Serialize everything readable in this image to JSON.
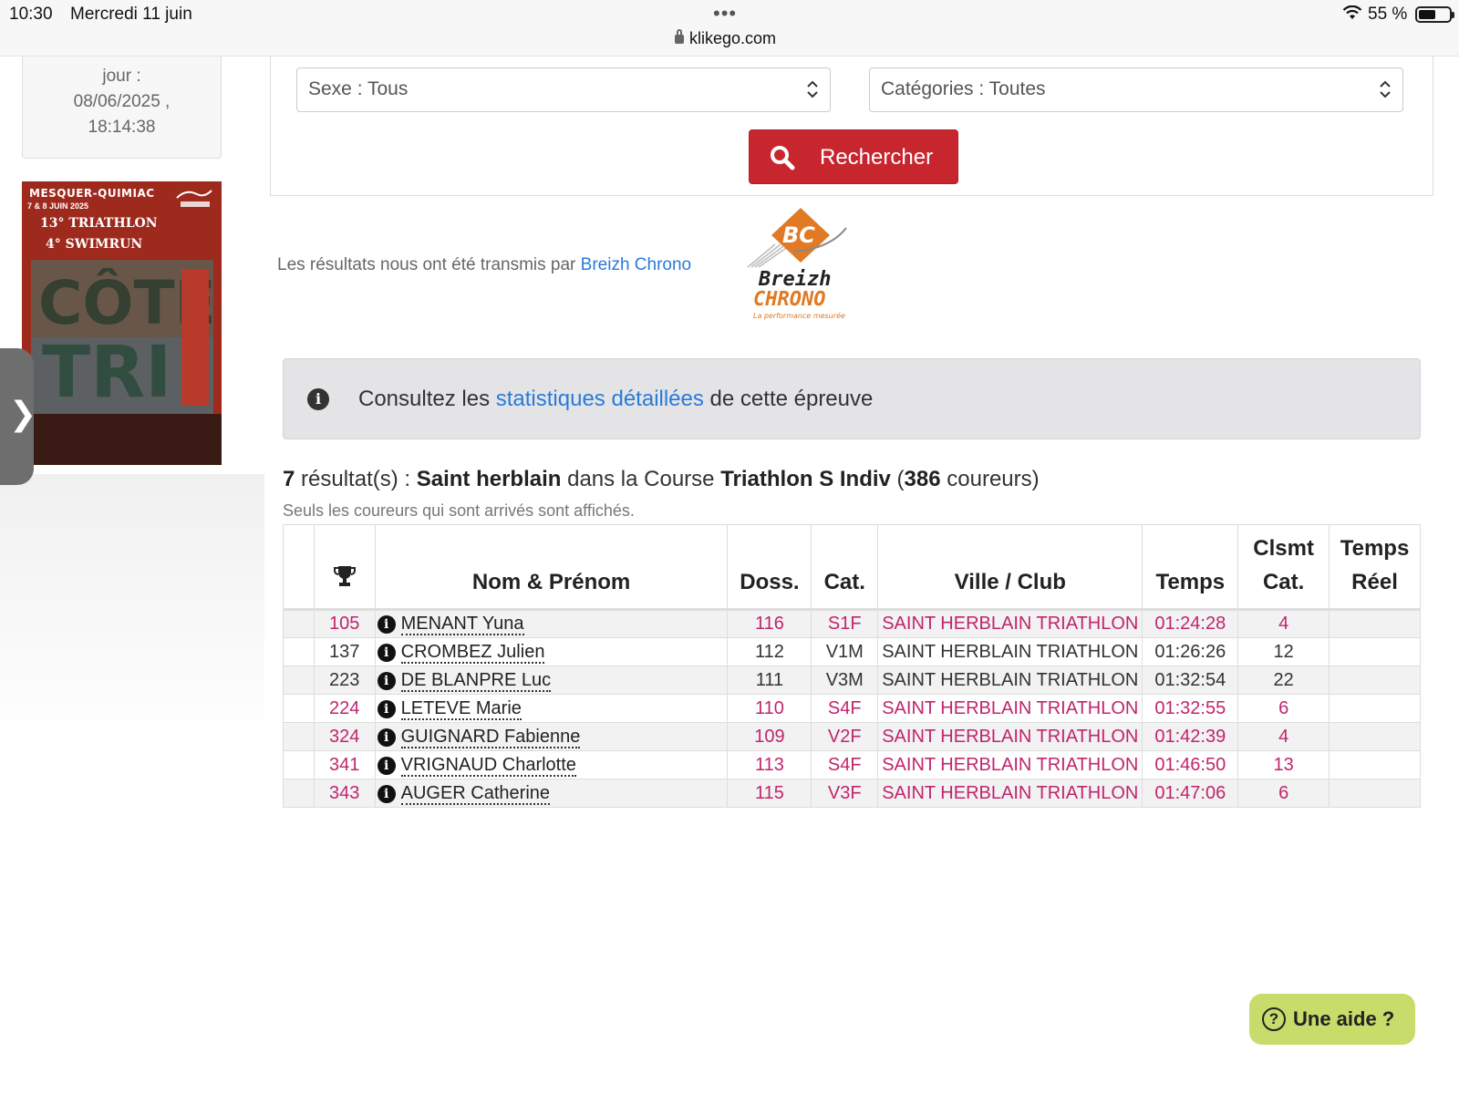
{
  "status_bar": {
    "time": "10:30",
    "date": "Mercredi 11 juin",
    "dots": "•••",
    "url": "klikego.com",
    "battery": "55 %"
  },
  "sidebar": {
    "update_lines": [
      "jour :",
      "08/06/2025 ,",
      "18:14:38"
    ],
    "poster": {
      "title": "MESQUER-QUIMIAC",
      "dates": "7 & 8 JUIN 2025",
      "line1": "13° TRIATHLON",
      "line2": "4° SWIMRUN"
    },
    "toggle": "❯"
  },
  "filters": {
    "sexe": "Sexe : Tous",
    "categories": "Catégories : Toutes",
    "search_label": "Rechercher"
  },
  "provider": {
    "text": "Les résultats nous ont été transmis par ",
    "link": "Breizh Chrono",
    "logo_text1": "Breizh",
    "logo_text2": "CHRONO",
    "logo_text3": "La performance mesurée"
  },
  "info": {
    "before": "Consultez les ",
    "link": "statistiques détaillées",
    "after": " de cette épreuve"
  },
  "result": {
    "count": "7",
    "label": " résultat(s) : ",
    "club": "Saint herblain",
    "middle": " dans la Course ",
    "course": "Triathlon S Indiv",
    "open": " (",
    "runners": "386",
    "close": " coureurs)",
    "subtitle": "Seuls les coureurs qui sont arrivés sont affichés."
  },
  "table": {
    "headers": {
      "name": "Nom & Prénom",
      "doss": "Doss.",
      "cat": "Cat.",
      "club": "Ville / Club",
      "time": "Temps",
      "clsmt": "Clsmt Cat.",
      "real": "Temps Réel"
    },
    "rows": [
      {
        "rank": "105",
        "name": "MENANT Yuna",
        "doss": "116",
        "cat": "S1F",
        "club": "SAINT HERBLAIN TRIATHLON",
        "time": "01:24:28",
        "clsmt": "4",
        "real": "",
        "highlight": true
      },
      {
        "rank": "137",
        "name": "CROMBEZ Julien",
        "doss": "112",
        "cat": "V1M",
        "club": "SAINT HERBLAIN TRIATHLON",
        "time": "01:26:26",
        "clsmt": "12",
        "real": "",
        "highlight": false
      },
      {
        "rank": "223",
        "name": "DE BLANPRE Luc",
        "doss": "111",
        "cat": "V3M",
        "club": "SAINT HERBLAIN TRIATHLON",
        "time": "01:32:54",
        "clsmt": "22",
        "real": "",
        "highlight": false
      },
      {
        "rank": "224",
        "name": "LETEVE Marie",
        "doss": "110",
        "cat": "S4F",
        "club": "SAINT HERBLAIN TRIATHLON",
        "time": "01:32:55",
        "clsmt": "6",
        "real": "",
        "highlight": true
      },
      {
        "rank": "324",
        "name": "GUIGNARD Fabienne",
        "doss": "109",
        "cat": "V2F",
        "club": "SAINT HERBLAIN TRIATHLON",
        "time": "01:42:39",
        "clsmt": "4",
        "real": "",
        "highlight": true
      },
      {
        "rank": "341",
        "name": "VRIGNAUD Charlotte",
        "doss": "113",
        "cat": "S4F",
        "club": "SAINT HERBLAIN TRIATHLON",
        "time": "01:46:50",
        "clsmt": "13",
        "real": "",
        "highlight": true
      },
      {
        "rank": "343",
        "name": "AUGER Catherine",
        "doss": "115",
        "cat": "V3F",
        "club": "SAINT HERBLAIN TRIATHLON",
        "time": "01:47:06",
        "clsmt": "6",
        "real": "",
        "highlight": true
      }
    ]
  },
  "help": {
    "label": "Une aide ?"
  },
  "colors": {
    "accent_red": "#c8262f",
    "link_blue": "#2a7ad8",
    "female_pink": "#c0256e",
    "help_green": "#c7dc6a"
  },
  "icons": {
    "search": "search-icon",
    "info": "info-icon",
    "trophy": "trophy-icon",
    "help": "question-icon"
  }
}
